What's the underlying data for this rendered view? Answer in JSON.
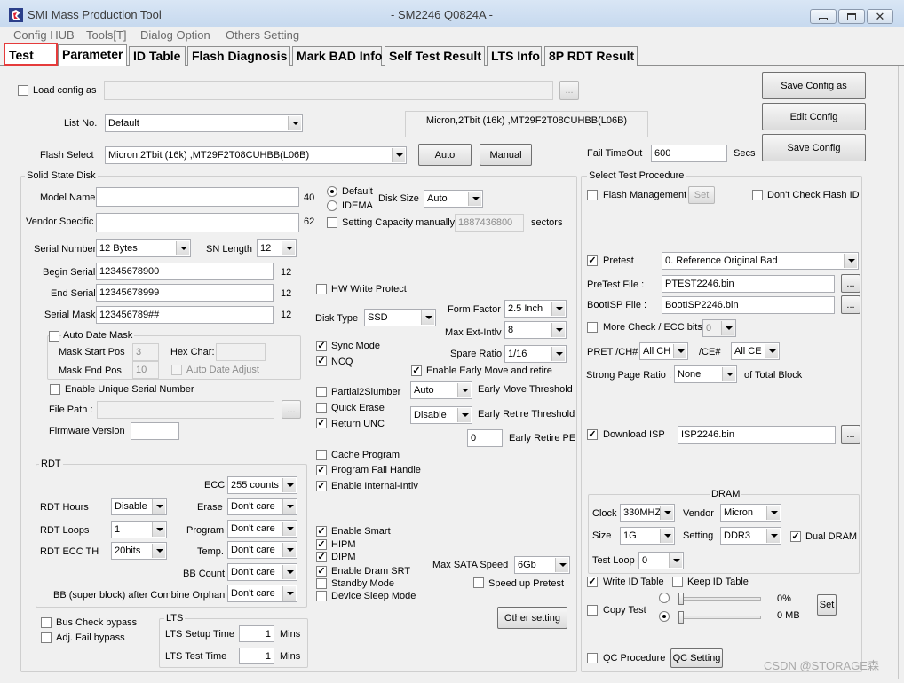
{
  "window": {
    "title": "SMI Mass Production Tool",
    "subtitle": "- SM2246 Q0824A -"
  },
  "menu": [
    "Config HUB",
    "Tools[T]",
    "Dialog Option",
    "Others Setting"
  ],
  "tabs": [
    "Test",
    "Parameter",
    "ID Table",
    "Flash Diagnosis",
    "Mark BAD Info",
    "Self Test Result",
    "LTS Info",
    "8P RDT Result"
  ],
  "annotation": "⑨",
  "top": {
    "load_config_label": "Load config as",
    "load_config_value": "",
    "browse": "...",
    "list_no_label": "List No.",
    "list_no_value": "Default",
    "flash_info": "Micron,2Tbit (16k) ,MT29F2T08CUHBB(L06B)",
    "flash_select_label": "Flash Select",
    "flash_select_value": "Micron,2Tbit (16k) ,MT29F2T08CUHBB(L06B)",
    "auto_btn": "Auto",
    "manual_btn": "Manual",
    "fail_timeout_label": "Fail TimeOut",
    "fail_timeout_value": "600",
    "secs": "Secs",
    "save_config_as": "Save Config as",
    "edit_config": "Edit Config",
    "save_config": "Save Config"
  },
  "ssd": {
    "title": "Solid State Disk",
    "model_name_label": "Model Name",
    "model_name_value": "",
    "model_len": "40",
    "vendor_label": "Vendor Specific",
    "vendor_value": "",
    "vendor_len": "62",
    "default_label": "Default",
    "idema_label": "IDEMA",
    "disk_size_label": "Disk Size",
    "disk_size_value": "Auto",
    "setting_cap_label": "Setting Capacity manually",
    "capacity_value": "1887436800",
    "sectors": "sectors",
    "serial_number_label": "Serial Number",
    "serial_number_value": "12 Bytes",
    "sn_length_label": "SN Length",
    "sn_length_value": "12",
    "begin_serial_label": "Begin Serial",
    "begin_serial_value": "12345678900",
    "begin_len": "12",
    "end_serial_label": "End Serial",
    "end_serial_value": "12345678999",
    "end_len": "12",
    "serial_mask_label": "Serial Mask",
    "serial_mask_value": "123456789##",
    "mask_len": "12",
    "auto_date_mask": "Auto Date Mask",
    "mask_start_label": "Mask Start Pos",
    "mask_start_value": "3",
    "hex_char_label": "Hex Char:",
    "hex_char_value": "",
    "mask_end_label": "Mask End Pos",
    "mask_end_value": "10",
    "auto_date_adjust": "Auto Date Adjust",
    "unique_serial": "Enable Unique Serial Number",
    "file_path_label": "File Path :",
    "file_path_value": "",
    "firmware_label": "Firmware Version",
    "firmware_value": ""
  },
  "mid": {
    "hw_write_protect": "HW Write Protect",
    "disk_type_label": "Disk Type",
    "disk_type_value": "SSD",
    "form_factor_label": "Form Factor",
    "form_factor_value": "2.5 Inch",
    "max_ext_label": "Max Ext-Intlv",
    "max_ext_value": "8",
    "spare_ratio_label": "Spare Ratio",
    "spare_ratio_value": "1/16",
    "sync_mode": "Sync Mode",
    "ncq": "NCQ",
    "early_move": "Enable Early Move and retire",
    "partial2slumber": "Partial2Slumber",
    "quick_erase": "Quick Erase",
    "return_unc": "Return UNC",
    "early_move_thr_value": "Auto",
    "early_move_thr_label": "Early Move Threshold",
    "early_retire_thr_value": "Disable",
    "early_retire_thr_label": "Early Retire Threshold",
    "early_retire_pe_value": "0",
    "early_retire_pe_label": "Early Retire PE",
    "cache_program": "Cache Program",
    "program_fail": "Program Fail Handle",
    "enable_internal": "Enable Internal-Intlv",
    "enable_smart": "Enable Smart",
    "hipm": "HIPM",
    "dipm": "DIPM",
    "enable_dram_srt": "Enable Dram SRT",
    "standby_mode": "Standby Mode",
    "device_sleep": "Device Sleep Mode",
    "max_sata_label": "Max SATA Speed",
    "max_sata_value": "6Gb",
    "speed_up": "Speed up Pretest",
    "other_setting": "Other setting"
  },
  "rdt": {
    "title": "RDT",
    "ecc_label": "ECC",
    "ecc_value": "255 counts",
    "hours_label": "RDT Hours",
    "hours_value": "Disable",
    "erase_label": "Erase",
    "erase_value": "Don't care",
    "loops_label": "RDT Loops",
    "loops_value": "1",
    "program_label": "Program",
    "program_value": "Don't care",
    "ecc_th_label": "RDT ECC TH",
    "ecc_th_value": "20bits",
    "temp_label": "Temp.",
    "temp_value": "Don't care",
    "bb_count_label": "BB Count",
    "bb_count_value": "Don't care",
    "bb_super_label": "BB (super block) after Combine Orphan",
    "bb_super_value": "Don't care"
  },
  "bottom": {
    "bus_check": "Bus Check bypass",
    "adj_fail": "Adj. Fail bypass",
    "lts_title": "LTS",
    "lts_setup_label": "LTS Setup Time",
    "lts_setup_value": "1",
    "lts_test_label": "LTS Test Time",
    "lts_test_value": "1",
    "mins": "Mins"
  },
  "procedure": {
    "title": "Select Test Procedure",
    "flash_mgmt": "Flash Management",
    "set": "Set",
    "dont_check_flash": "Don't Check Flash ID",
    "pretest": "Pretest",
    "pretest_value": "0. Reference Original Bad",
    "pretest_file_label": "PreTest File :",
    "pretest_file_value": "PTEST2246.bin",
    "bootisp_label": "BootISP File :",
    "bootisp_value": "BootISP2246.bin",
    "more_check": "More Check / ECC bits",
    "more_check_value": "0",
    "pret_ch_label": "PRET /CH#",
    "pret_ch_value": "All CH",
    "ce_label": "/CE#",
    "ce_value": "All CE",
    "strong_page_label": "Strong Page Ratio :",
    "strong_page_value": "None",
    "of_total": "of Total Block",
    "download_isp": "Download ISP",
    "isp_value": "ISP2246.bin",
    "dram_title": "DRAM",
    "clock_label": "Clock",
    "clock_value": "330MHZ",
    "vendor_label": "Vendor",
    "vendor_value": "Micron",
    "size_label": "Size",
    "size_value": "1G",
    "setting_label": "Setting",
    "setting_value": "DDR3",
    "dual_dram": "Dual DRAM",
    "test_loop_label": "Test Loop",
    "test_loop_value": "0",
    "write_id": "Write ID Table",
    "keep_id": "Keep ID Table",
    "copy_test": "Copy Test",
    "pct": "0%",
    "mb": "0 MB",
    "set_btn": "Set",
    "qc_procedure": "QC Procedure",
    "qc_setting": "QC Setting"
  },
  "watermark": "CSDN @STORAGE森"
}
